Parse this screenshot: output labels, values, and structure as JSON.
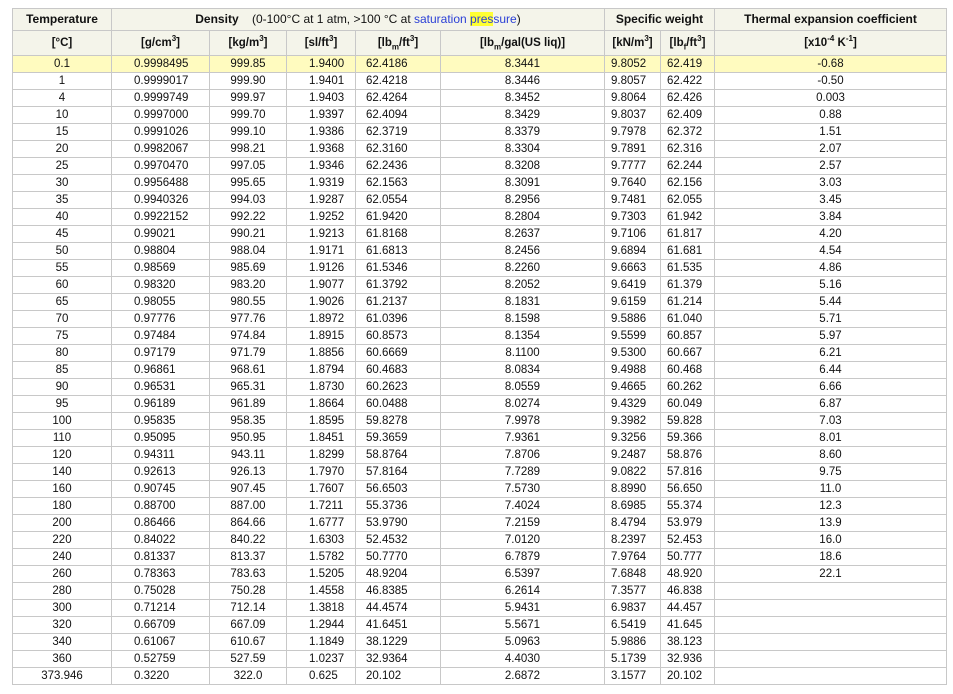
{
  "header": {
    "temperature": "Temperature",
    "density_label": "Density",
    "density_note_prefix": "(0-100°C at 1 atm, >100 °C at ",
    "density_note_link1": "saturation",
    "density_note_link2_hl": "pres",
    "density_note_link2_rest": "sure",
    "density_note_suffix": ")",
    "specific_weight": "Specific weight",
    "thermal": "Thermal expansion coefficient"
  },
  "units": {
    "temp": "[°C]",
    "g_cm3": {
      "pre": "[g/cm",
      "sup": "3",
      "post": "]"
    },
    "kg_m3": {
      "pre": "[kg/m",
      "sup": "3",
      "post": "]"
    },
    "sl_ft3": {
      "pre": "[sl/ft",
      "sup": "3",
      "post": "]"
    },
    "lbm_ft3": {
      "pre": "[lb",
      "sub": "m",
      "mid": "/ft",
      "sup": "3",
      "post": "]"
    },
    "lbm_gal": {
      "pre": "[lb",
      "sub": "m",
      "post": "/gal(US liq)]"
    },
    "kn_m3": {
      "pre": "[kN/m",
      "sup": "3",
      "post": "]"
    },
    "lbf_ft3": {
      "pre": "[lb",
      "sub": "f",
      "mid": "/ft",
      "sup": "3",
      "post": "]"
    },
    "thermal": {
      "pre": "[x10",
      "sup1": "-4",
      "mid": " K",
      "sup2": "-1",
      "post": "]"
    }
  },
  "rows": [
    [
      "0.1",
      "0.9998495",
      "999.85",
      "1.9400",
      "62.4186",
      "8.3441",
      "9.8052",
      "62.419",
      "-0.68"
    ],
    [
      "1",
      "0.9999017",
      "999.90",
      "1.9401",
      "62.4218",
      "8.3446",
      "9.8057",
      "62.422",
      "-0.50"
    ],
    [
      "4",
      "0.9999749",
      "999.97",
      "1.9403",
      "62.4264",
      "8.3452",
      "9.8064",
      "62.426",
      "0.003"
    ],
    [
      "10",
      "0.9997000",
      "999.70",
      "1.9397",
      "62.4094",
      "8.3429",
      "9.8037",
      "62.409",
      "0.88"
    ],
    [
      "15",
      "0.9991026",
      "999.10",
      "1.9386",
      "62.3719",
      "8.3379",
      "9.7978",
      "62.372",
      "1.51"
    ],
    [
      "20",
      "0.9982067",
      "998.21",
      "1.9368",
      "62.3160",
      "8.3304",
      "9.7891",
      "62.316",
      "2.07"
    ],
    [
      "25",
      "0.9970470",
      "997.05",
      "1.9346",
      "62.2436",
      "8.3208",
      "9.7777",
      "62.244",
      "2.57"
    ],
    [
      "30",
      "0.9956488",
      "995.65",
      "1.9319",
      "62.1563",
      "8.3091",
      "9.7640",
      "62.156",
      "3.03"
    ],
    [
      "35",
      "0.9940326",
      "994.03",
      "1.9287",
      "62.0554",
      "8.2956",
      "9.7481",
      "62.055",
      "3.45"
    ],
    [
      "40",
      "0.9922152",
      "992.22",
      "1.9252",
      "61.9420",
      "8.2804",
      "9.7303",
      "61.942",
      "3.84"
    ],
    [
      "45",
      "0.99021",
      "990.21",
      "1.9213",
      "61.8168",
      "8.2637",
      "9.7106",
      "61.817",
      "4.20"
    ],
    [
      "50",
      "0.98804",
      "988.04",
      "1.9171",
      "61.6813",
      "8.2456",
      "9.6894",
      "61.681",
      "4.54"
    ],
    [
      "55",
      "0.98569",
      "985.69",
      "1.9126",
      "61.5346",
      "8.2260",
      "9.6663",
      "61.535",
      "4.86"
    ],
    [
      "60",
      "0.98320",
      "983.20",
      "1.9077",
      "61.3792",
      "8.2052",
      "9.6419",
      "61.379",
      "5.16"
    ],
    [
      "65",
      "0.98055",
      "980.55",
      "1.9026",
      "61.2137",
      "8.1831",
      "9.6159",
      "61.214",
      "5.44"
    ],
    [
      "70",
      "0.97776",
      "977.76",
      "1.8972",
      "61.0396",
      "8.1598",
      "9.5886",
      "61.040",
      "5.71"
    ],
    [
      "75",
      "0.97484",
      "974.84",
      "1.8915",
      "60.8573",
      "8.1354",
      "9.5599",
      "60.857",
      "5.97"
    ],
    [
      "80",
      "0.97179",
      "971.79",
      "1.8856",
      "60.6669",
      "8.1100",
      "9.5300",
      "60.667",
      "6.21"
    ],
    [
      "85",
      "0.96861",
      "968.61",
      "1.8794",
      "60.4683",
      "8.0834",
      "9.4988",
      "60.468",
      "6.44"
    ],
    [
      "90",
      "0.96531",
      "965.31",
      "1.8730",
      "60.2623",
      "8.0559",
      "9.4665",
      "60.262",
      "6.66"
    ],
    [
      "95",
      "0.96189",
      "961.89",
      "1.8664",
      "60.0488",
      "8.0274",
      "9.4329",
      "60.049",
      "6.87"
    ],
    [
      "100",
      "0.95835",
      "958.35",
      "1.8595",
      "59.8278",
      "7.9978",
      "9.3982",
      "59.828",
      "7.03"
    ],
    [
      "110",
      "0.95095",
      "950.95",
      "1.8451",
      "59.3659",
      "7.9361",
      "9.3256",
      "59.366",
      "8.01"
    ],
    [
      "120",
      "0.94311",
      "943.11",
      "1.8299",
      "58.8764",
      "7.8706",
      "9.2487",
      "58.876",
      "8.60"
    ],
    [
      "140",
      "0.92613",
      "926.13",
      "1.7970",
      "57.8164",
      "7.7289",
      "9.0822",
      "57.816",
      "9.75"
    ],
    [
      "160",
      "0.90745",
      "907.45",
      "1.7607",
      "56.6503",
      "7.5730",
      "8.8990",
      "56.650",
      "11.0"
    ],
    [
      "180",
      "0.88700",
      "887.00",
      "1.7211",
      "55.3736",
      "7.4024",
      "8.6985",
      "55.374",
      "12.3"
    ],
    [
      "200",
      "0.86466",
      "864.66",
      "1.6777",
      "53.9790",
      "7.2159",
      "8.4794",
      "53.979",
      "13.9"
    ],
    [
      "220",
      "0.84022",
      "840.22",
      "1.6303",
      "52.4532",
      "7.0120",
      "8.2397",
      "52.453",
      "16.0"
    ],
    [
      "240",
      "0.81337",
      "813.37",
      "1.5782",
      "50.7770",
      "6.7879",
      "7.9764",
      "50.777",
      "18.6"
    ],
    [
      "260",
      "0.78363",
      "783.63",
      "1.5205",
      "48.9204",
      "6.5397",
      "7.6848",
      "48.920",
      "22.1"
    ],
    [
      "280",
      "0.75028",
      "750.28",
      "1.4558",
      "46.8385",
      "6.2614",
      "7.3577",
      "46.838",
      ""
    ],
    [
      "300",
      "0.71214",
      "712.14",
      "1.3818",
      "44.4574",
      "5.9431",
      "6.9837",
      "44.457",
      ""
    ],
    [
      "320",
      "0.66709",
      "667.09",
      "1.2944",
      "41.6451",
      "5.5671",
      "6.5419",
      "41.645",
      ""
    ],
    [
      "340",
      "0.61067",
      "610.67",
      "1.1849",
      "38.1229",
      "5.0963",
      "5.9886",
      "38.123",
      ""
    ],
    [
      "360",
      "0.52759",
      "527.59",
      "1.0237",
      "32.9364",
      "4.4030",
      "5.1739",
      "32.936",
      ""
    ],
    [
      "373.946",
      "0.3220",
      "322.0",
      "0.625",
      "20.102",
      "2.6872",
      "3.1577",
      "20.102",
      ""
    ]
  ]
}
